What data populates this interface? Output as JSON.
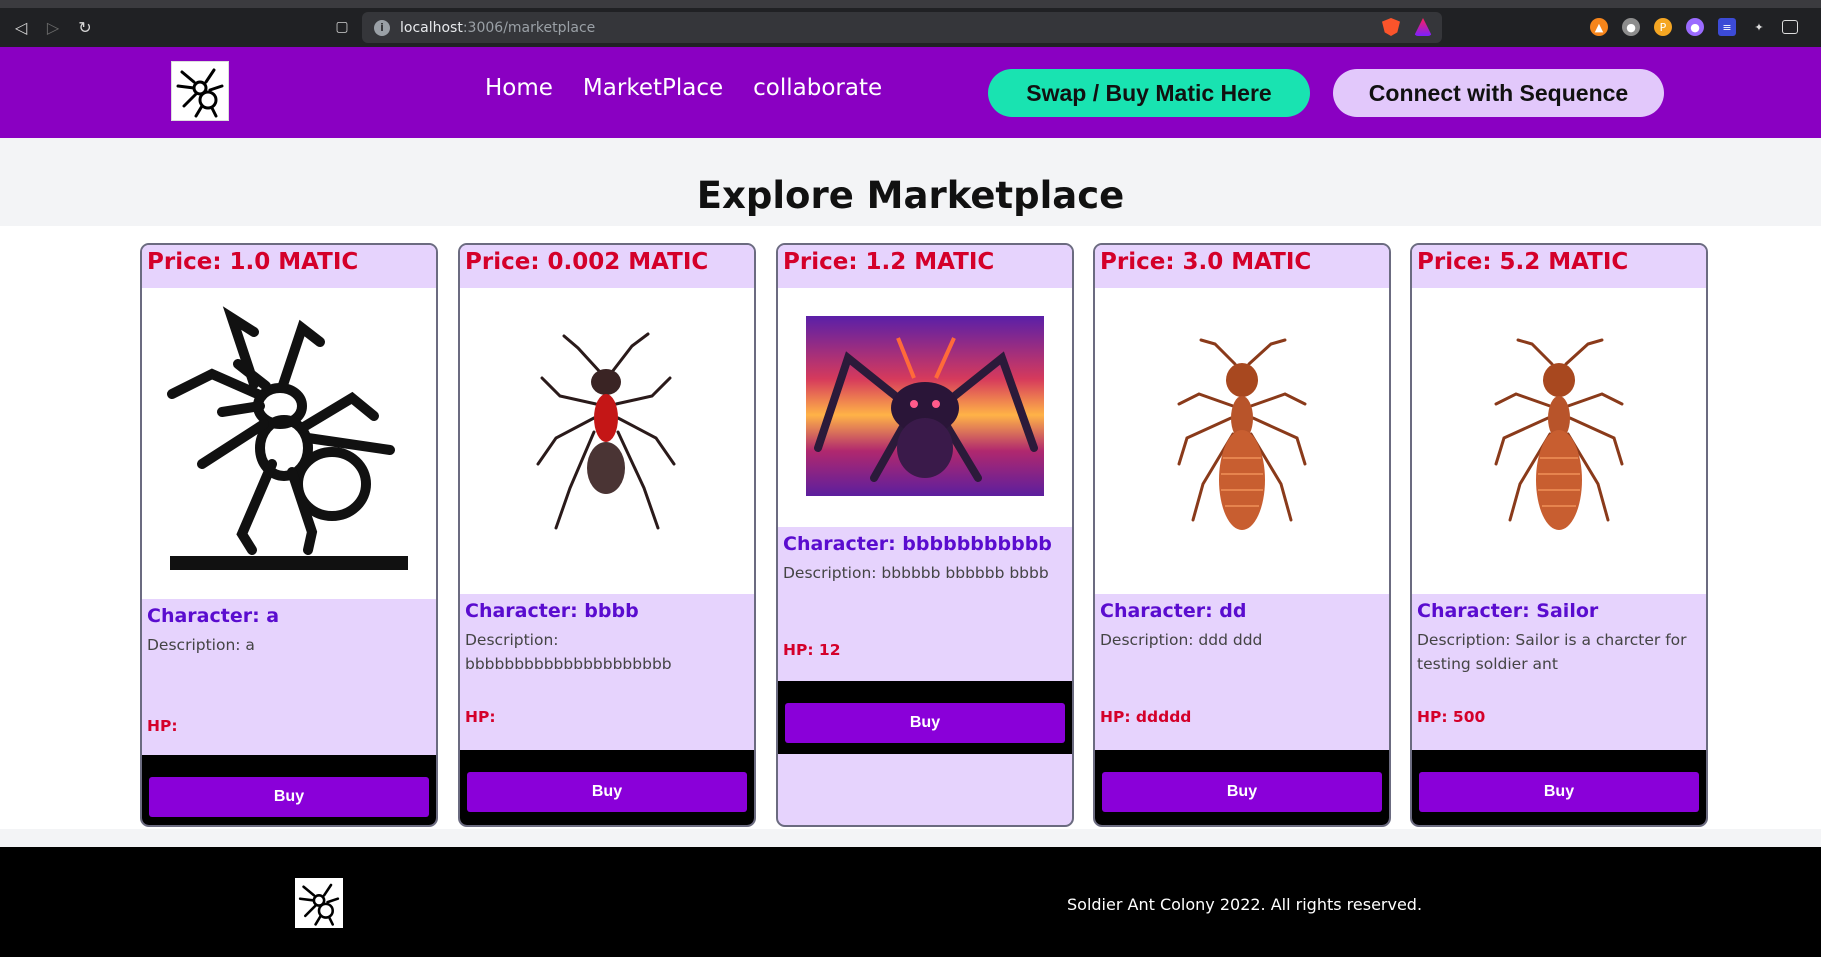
{
  "browser": {
    "url_host": "localhost",
    "url_path": ":3006/marketplace"
  },
  "header": {
    "nav": [
      "Home",
      "MarketPlace",
      "collaborate"
    ],
    "swap_label": "Swap / Buy Matic Here",
    "connect_label": "Connect with Sequence"
  },
  "page": {
    "title": "Explore Marketplace"
  },
  "cards": [
    {
      "price": "Price: 1.0 MATIC",
      "character": "Character: a",
      "description": "Description: a",
      "hp": "HP:",
      "buy": "Buy",
      "image": "black-ant-drawing"
    },
    {
      "price": "Price: 0.002 MATIC",
      "character": "Character: bbbb",
      "description": "Description: bbbbbbbbbbbbbbbbbbbbb",
      "hp": "HP:",
      "buy": "Buy",
      "image": "red-black-ant"
    },
    {
      "price": "Price: 1.2 MATIC",
      "character": "Character: bbbbbbbbbbb",
      "description": "Description: bbbbbb bbbbbb bbbb",
      "hp": "HP: 12",
      "buy": "Buy",
      "image": "sunset-ant-illustration"
    },
    {
      "price": "Price: 3.0 MATIC",
      "character": "Character: dd",
      "description": "Description: ddd ddd",
      "hp": "HP: ddddd",
      "buy": "Buy",
      "image": "orange-ant"
    },
    {
      "price": "Price: 5.2 MATIC",
      "character": "Character: Sailor",
      "description": "Description: Sailor is a charcter for testing soldier ant",
      "hp": "HP: 500",
      "buy": "Buy",
      "image": "orange-ant"
    }
  ],
  "footer": {
    "text": "Soldier Ant Colony 2022. All rights reserved."
  },
  "colors": {
    "header": "#8a00c2",
    "swap": "#19e3b1",
    "connect": "#e2c8fb",
    "card_bg": "#e6d3fd",
    "price": "#d4002a",
    "character": "#5a0ccf",
    "buy": "#8a00d9"
  }
}
